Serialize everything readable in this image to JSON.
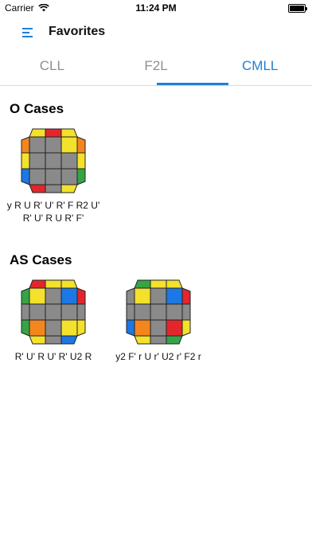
{
  "status": {
    "carrier": "Carrier",
    "time": "11:24 PM"
  },
  "nav": {
    "title": "Favorites"
  },
  "tabs": [
    {
      "label": "CLL",
      "active": false
    },
    {
      "label": "F2L",
      "active": false
    },
    {
      "label": "CMLL",
      "active": true
    }
  ],
  "colors": {
    "accent": "#1f7fd6",
    "Y": "#f3e12c",
    "G": "#35a447",
    "B": "#1c78e4",
    "R": "#e4262c",
    "O": "#f4861e",
    "X": "#8a8a8a"
  },
  "sections": [
    {
      "title": "O Cases",
      "cases": [
        {
          "alg": "y R U R' U' R' F R2 U' R' U' R U R' F'",
          "stickers": {
            "top": [
              "Y",
              "R",
              "Y"
            ],
            "bottom": [
              "R",
              "X",
              "Y"
            ],
            "left": [
              "O",
              "Y",
              "B"
            ],
            "right": [
              "O",
              "Y",
              "G"
            ],
            "grid": [
              [
                "X",
                "X",
                "Y"
              ],
              [
                "X",
                "X",
                "X"
              ],
              [
                "X",
                "X",
                "X"
              ]
            ]
          }
        }
      ]
    },
    {
      "title": "AS Cases",
      "cases": [
        {
          "alg": "R' U' R U' R' U2 R",
          "stickers": {
            "top": [
              "R",
              "Y",
              "Y"
            ],
            "bottom": [
              "Y",
              "X",
              "B"
            ],
            "left": [
              "G",
              "X",
              "G"
            ],
            "right": [
              "R",
              "X",
              "Y"
            ],
            "grid": [
              [
                "Y",
                "X",
                "B"
              ],
              [
                "X",
                "X",
                "X"
              ],
              [
                "O",
                "X",
                "Y"
              ]
            ]
          }
        },
        {
          "alg": "y2 F' r U r' U2 r' F2 r",
          "stickers": {
            "top": [
              "G",
              "Y",
              "Y"
            ],
            "bottom": [
              "Y",
              "X",
              "G"
            ],
            "left": [
              "X",
              "X",
              "B"
            ],
            "right": [
              "R",
              "X",
              "Y"
            ],
            "grid": [
              [
                "Y",
                "X",
                "B"
              ],
              [
                "X",
                "X",
                "X"
              ],
              [
                "O",
                "X",
                "R"
              ]
            ]
          }
        }
      ]
    }
  ]
}
